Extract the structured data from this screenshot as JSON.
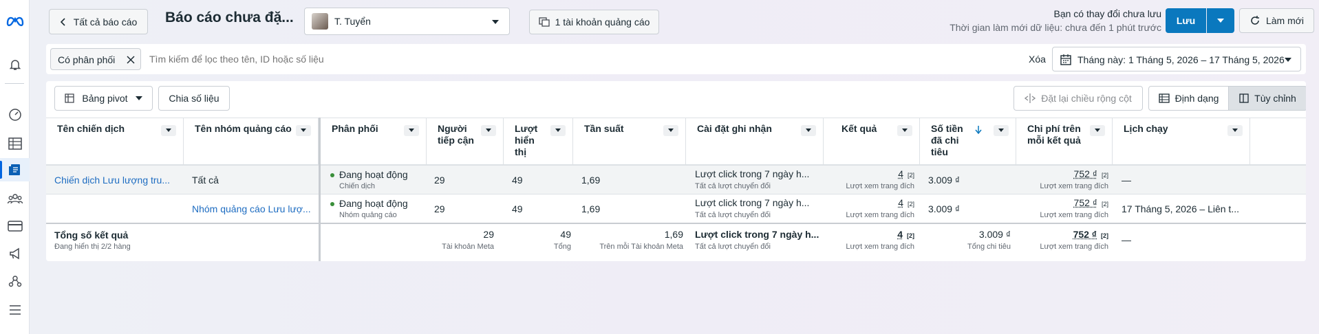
{
  "header": {
    "back_label": "Tất cả báo cáo",
    "title": "Báo cáo chưa đặ...",
    "user_name": "T. Tuyển",
    "ad_accounts_label": "1 tài khoản quảng cáo",
    "unsaved_text": "Bạn có thay đổi chưa lưu",
    "refresh_time_text": "Thời gian làm mới dữ liệu: chưa đến 1 phút trước",
    "save_label": "Lưu",
    "refresh_label": "Làm mới"
  },
  "filter": {
    "chip_label": "Có phân phối",
    "search_placeholder": "Tìm kiếm để lọc theo tên, ID hoặc số liệu",
    "clear_label": "Xóa",
    "date_range": "Tháng này: 1 Tháng 5, 2026 – 17 Tháng 5, 2026"
  },
  "toolbar": {
    "pivot_label": "Bảng pivot",
    "breakdown_label": "Chia số liệu",
    "reset_width_label": "Đặt lại chiều rộng cột",
    "format_label": "Định dạng",
    "customize_label": "Tùy chỉnh"
  },
  "columns": [
    {
      "l1": "Tên chiến dịch"
    },
    {
      "l1": "Tên nhóm quảng cáo"
    },
    {
      "l1": "Phân phối"
    },
    {
      "l1": "Người",
      "l2": "tiếp cận"
    },
    {
      "l1": "Lượt",
      "l2": "hiển",
      "l3": "thị"
    },
    {
      "l1": "Tần suất"
    },
    {
      "l1": "Cài đặt ghi nhận"
    },
    {
      "l1": "Kết quả"
    },
    {
      "l1": "Số tiền",
      "l2": "đã chi",
      "l3": "tiêu"
    },
    {
      "l1": "Chi phí trên",
      "l2": "mỗi kết quả"
    },
    {
      "l1": "Lịch chạy"
    }
  ],
  "rows": [
    {
      "campaign": "Chiến dịch Lưu lượng tru...",
      "adset": "Tất cả",
      "delivery": "Đang hoạt động",
      "delivery_sub": "Chiến dịch",
      "reach": "29",
      "impressions": "49",
      "frequency": "1,69",
      "attribution": "Lượt click trong 7 ngày h...",
      "attribution_sub": "Tất cả lượt chuyển đổi",
      "results": "4",
      "results_sup": "[2]",
      "results_sub": "Lượt xem trang đích",
      "spend": "3.009 ₫",
      "cpr": "752 ₫",
      "cpr_sup": "[2]",
      "cpr_sub": "Lượt xem trang đích",
      "schedule": "—"
    },
    {
      "campaign": "",
      "adset": "Nhóm quảng cáo Lưu lượ...",
      "delivery": "Đang hoạt động",
      "delivery_sub": "Nhóm quảng cáo",
      "reach": "29",
      "impressions": "49",
      "frequency": "1,69",
      "attribution": "Lượt click trong 7 ngày h...",
      "attribution_sub": "Tất cả lượt chuyển đổi",
      "results": "4",
      "results_sup": "[2]",
      "results_sub": "Lượt xem trang đích",
      "spend": "3.009 ₫",
      "cpr": "752 ₫",
      "cpr_sup": "[2]",
      "cpr_sub": "Lượt xem trang đích",
      "schedule": "17 Tháng 5, 2026 – Liên t..."
    }
  ],
  "totals": {
    "label": "Tổng số kết quả",
    "sub": "Đang hiển thị 2/2 hàng",
    "reach": "29",
    "reach_sub": "Tài khoản Meta",
    "impressions": "49",
    "impressions_sub": "Tổng",
    "frequency": "1,69",
    "frequency_sub": "Trên mỗi Tài khoản Meta",
    "attribution": "Lượt click trong 7 ngày h...",
    "attribution_sub": "Tất cả lượt chuyển đổi",
    "results": "4",
    "results_sup": "[2]",
    "results_sub": "Lượt xem trang đích",
    "spend": "3.009 ₫",
    "spend_sub": "Tổng chi tiêu",
    "cpr": "752 ₫",
    "cpr_sup": "[2]",
    "cpr_sub": "Lượt xem trang đích",
    "schedule": "—"
  },
  "colors": {
    "accent": "#0a78be",
    "link": "#1d6cc1",
    "active_dot": "#3a8f3a"
  }
}
